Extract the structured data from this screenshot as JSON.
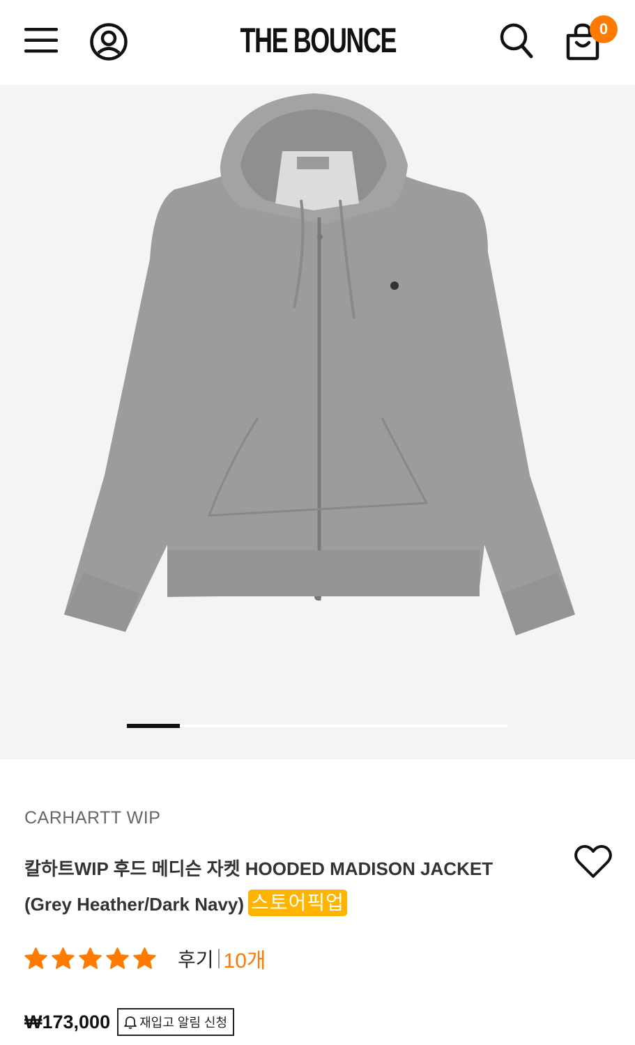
{
  "header": {
    "logo": "THE BOUNCE",
    "cart_count": "0",
    "icons": [
      "menu-icon",
      "user-icon",
      "search-icon",
      "shopping-bag-icon"
    ]
  },
  "gallery": {
    "image_alt": "Grey zip hoodie",
    "slide_progress": 0.14
  },
  "product": {
    "brand": "CARHARTT WIP",
    "title_line1": "칼하트WIP 후드 메디슨 자켓 HOODED MADISON JACKET",
    "title_line2": "(Grey Heather/Dark Navy)",
    "pickup_badge": "스토어픽업",
    "rating_stars": 5,
    "review_label": "후기",
    "review_count": "10개",
    "price": "₩173,000",
    "restock_button": "재입고 알림 신청"
  },
  "colors": {
    "accent": "#ff7a00",
    "badge": "#ffb400",
    "gallery_bg": "#f4f4f4"
  }
}
